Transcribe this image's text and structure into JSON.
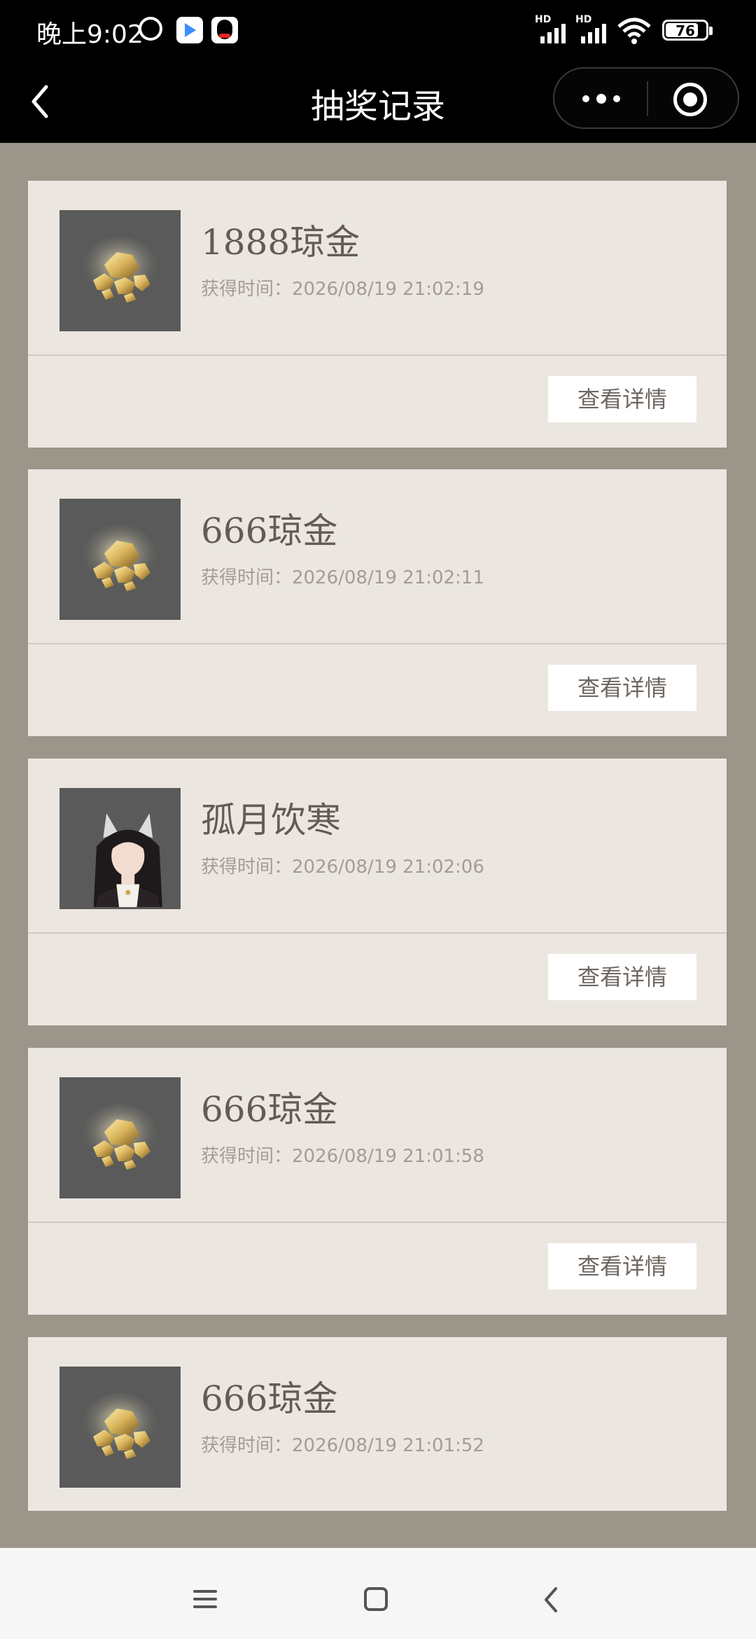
{
  "status_bar": {
    "time": "晚上9:02",
    "network_label_1": "HD",
    "network_label_2": "HD",
    "battery": "76",
    "icons": [
      "alarm-icon",
      "app-icon",
      "qq-icon",
      "signal-icon",
      "signal-icon",
      "wifi-icon",
      "battery-icon"
    ]
  },
  "header": {
    "title": "抽奖记录",
    "icons": [
      "back-icon",
      "more-icon",
      "target-icon"
    ]
  },
  "records": [
    {
      "name": "1888琼金",
      "time": "获得时间：2026/08/19 21:02:19",
      "thumb": "gold",
      "detail_label": "查看详情"
    },
    {
      "name": "666琼金",
      "time": "获得时间：2026/08/19 21:02:11",
      "thumb": "gold",
      "detail_label": "查看详情"
    },
    {
      "name": "孤月饮寒",
      "time": "获得时间：2026/08/19 21:02:06",
      "thumb": "character",
      "detail_label": "查看详情"
    },
    {
      "name": "666琼金",
      "time": "获得时间：2026/08/19 21:01:58",
      "thumb": "gold",
      "detail_label": "查看详情"
    },
    {
      "name": "666琼金",
      "time": "获得时间：2026/08/19 21:01:52",
      "thumb": "gold",
      "detail_label": ""
    }
  ],
  "nav_bar": {
    "icons": [
      "menu-icon",
      "home-icon",
      "back-icon"
    ]
  },
  "colors": {
    "page_background": "#9b958a",
    "card_background": "#ebe7e0",
    "thumb_background": "#5a5a5a",
    "title_text": "#665a55",
    "time_text": "#a39c96",
    "gold": "#c9a64a"
  }
}
